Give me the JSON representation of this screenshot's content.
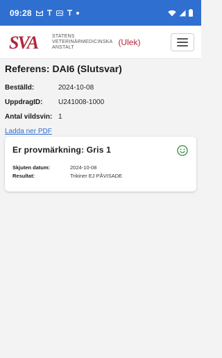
{
  "statusbar": {
    "time": "09:28",
    "notification_icons": [
      "gmail-icon",
      "antenna-icon",
      "cast-icon",
      "antenna-icon"
    ],
    "right_icons": [
      "wifi-icon",
      "signal-icon",
      "battery-icon"
    ]
  },
  "header": {
    "logo_mark": "SVA",
    "logo_lines": [
      "STATENS",
      "VETERINÄRMEDICINSKA",
      "ANSTALT"
    ],
    "app_tag": "(Ulek)",
    "brand_color": "#b0263a"
  },
  "referens": {
    "title": "Referens: DAI6  (Slutsvar)",
    "rows": [
      {
        "label": "Beställd:",
        "value": "2024-10-08"
      },
      {
        "label": "UppdragID:",
        "value": "U241008-1000"
      },
      {
        "label": "Antal vildsvin:",
        "value": "1"
      }
    ],
    "pdf_link": "Ladda ner PDF"
  },
  "card": {
    "title": "Er provmärkning: Gris 1",
    "status_icon": "smiley-icon",
    "status_color": "#2e8b3a",
    "rows": [
      {
        "label": "Skjuten datum:",
        "value": "2024-10-08"
      },
      {
        "label": "Resultat:",
        "value": "Trikiner EJ PÅVISADE"
      }
    ]
  }
}
